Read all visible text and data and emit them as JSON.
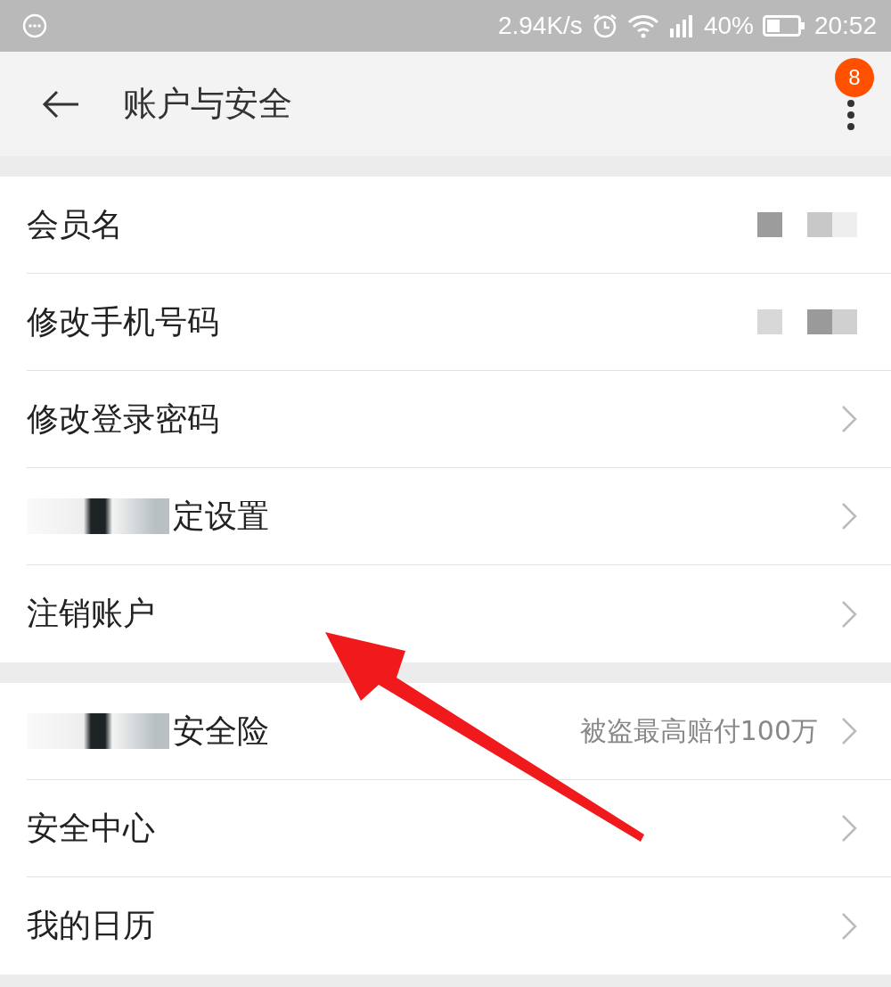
{
  "status_bar": {
    "network_speed": "2.94K/s",
    "battery": "40%",
    "time": "20:52"
  },
  "header": {
    "title": "账户与安全",
    "badge": "8"
  },
  "groups": [
    {
      "rows": [
        {
          "label": "会员名",
          "redacted_label": false,
          "redacted_value": true,
          "chevron": false
        },
        {
          "label": "修改手机号码",
          "redacted_label": false,
          "redacted_value": true,
          "chevron": false
        },
        {
          "label": "修改登录密码",
          "redacted_label": false,
          "redacted_value": false,
          "chevron": true
        },
        {
          "label": "定设置",
          "redacted_label": true,
          "redacted_value": false,
          "chevron": true
        },
        {
          "label": "注销账户",
          "redacted_label": false,
          "redacted_value": false,
          "chevron": true
        }
      ]
    },
    {
      "rows": [
        {
          "label": "安全险",
          "redacted_label": true,
          "redacted_value": false,
          "value": "被盗最高赔付100万",
          "chevron": true
        },
        {
          "label": "安全中心",
          "redacted_label": false,
          "redacted_value": false,
          "chevron": true
        },
        {
          "label": "我的日历",
          "redacted_label": false,
          "redacted_value": false,
          "chevron": true
        }
      ]
    }
  ],
  "annotation": {
    "kind": "arrow"
  }
}
